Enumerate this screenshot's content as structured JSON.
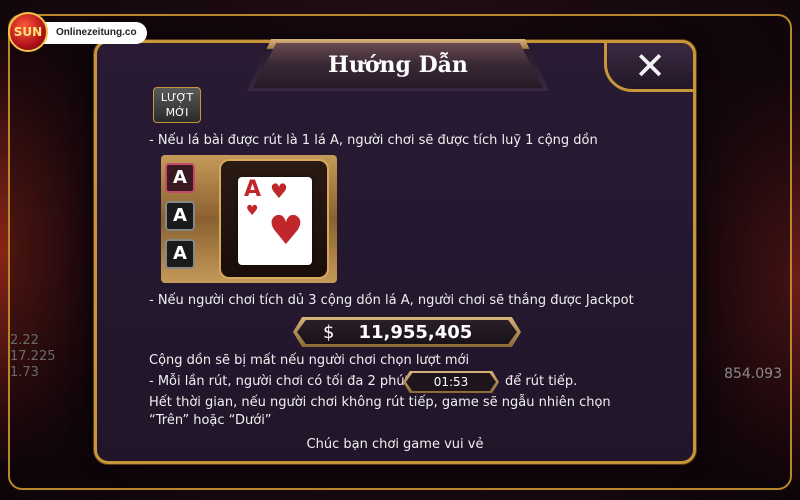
{
  "site": {
    "logo_text": "SUN",
    "domain": "Onlinezeitung.co"
  },
  "background": {
    "left_numbers": [
      "2.22",
      "17.225",
      "1.73"
    ],
    "right_number": "854.093"
  },
  "dialog": {
    "title": "Hướng Dẫn",
    "close_label": "✕",
    "badge_line1": "LƯỢT",
    "badge_line2": "MỚI",
    "line1": "- Nếu lá bài được rút là 1 lá A, người chơi sẽ được tích luỹ 1 cộng dồn",
    "cards": {
      "mini": [
        "A",
        "A",
        "A"
      ],
      "big_rank": "A",
      "suit": "♥"
    },
    "line2": "- Nếu người chơi tích dủ 3 cộng dồn lá A, người chơi sẽ thắng được Jackpot",
    "jackpot": {
      "currency": "$",
      "value": "11,955,405"
    },
    "line3": "Cộng dồn sẽ bị mất nếu người chơi chọn lượt mới",
    "line4_a": "- Mỗi lần rút, người chơi có tối đa 2 phút",
    "timer": "01:53",
    "line4_b": "để rút tiếp.",
    "line5": "Hết thời gian, nếu người chơi không rút tiếp, game sẽ ngẫu nhiên chọn",
    "line6": "“Trên” hoặc “Dưới”",
    "line7": "Chúc bạn chơi game vui vẻ"
  }
}
